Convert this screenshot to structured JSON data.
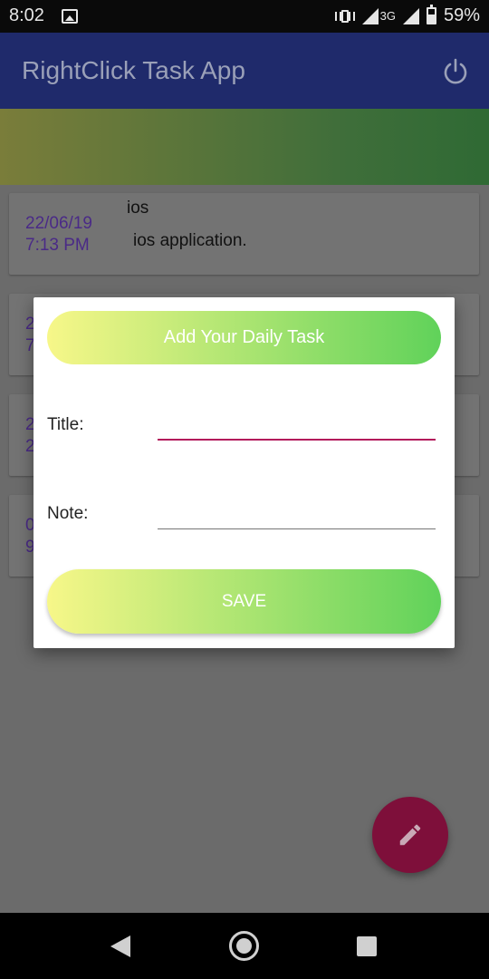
{
  "status_bar": {
    "time": "8:02",
    "network": "3G",
    "battery": "59%"
  },
  "app_bar": {
    "title": "RightClick Task App"
  },
  "tasks": [
    {
      "date": "22/06/19",
      "time": "7:13 PM",
      "title": "ios",
      "note": "ios application."
    },
    {
      "date": "2",
      "time": "7",
      "title": "",
      "note": ""
    },
    {
      "date": "2",
      "time": "2",
      "title": "",
      "note": ""
    },
    {
      "date": "0",
      "time": "9",
      "title": "",
      "note": ""
    }
  ],
  "dialog": {
    "header": "Add Your Daily Task",
    "title_label": "Title:",
    "title_value": "",
    "note_label": "Note:",
    "note_value": "",
    "save_label": "SAVE"
  },
  "colors": {
    "app_bar": "#1f2a6b",
    "accent": "#b3185b",
    "gradient_start": "#f7f789",
    "gradient_end": "#60d25a",
    "fab": "#7e0f3a"
  },
  "icons": {
    "power": "power-icon",
    "fab": "pencil-icon",
    "nav_back": "back-icon",
    "nav_home": "home-icon",
    "nav_recent": "recent-apps-icon"
  }
}
